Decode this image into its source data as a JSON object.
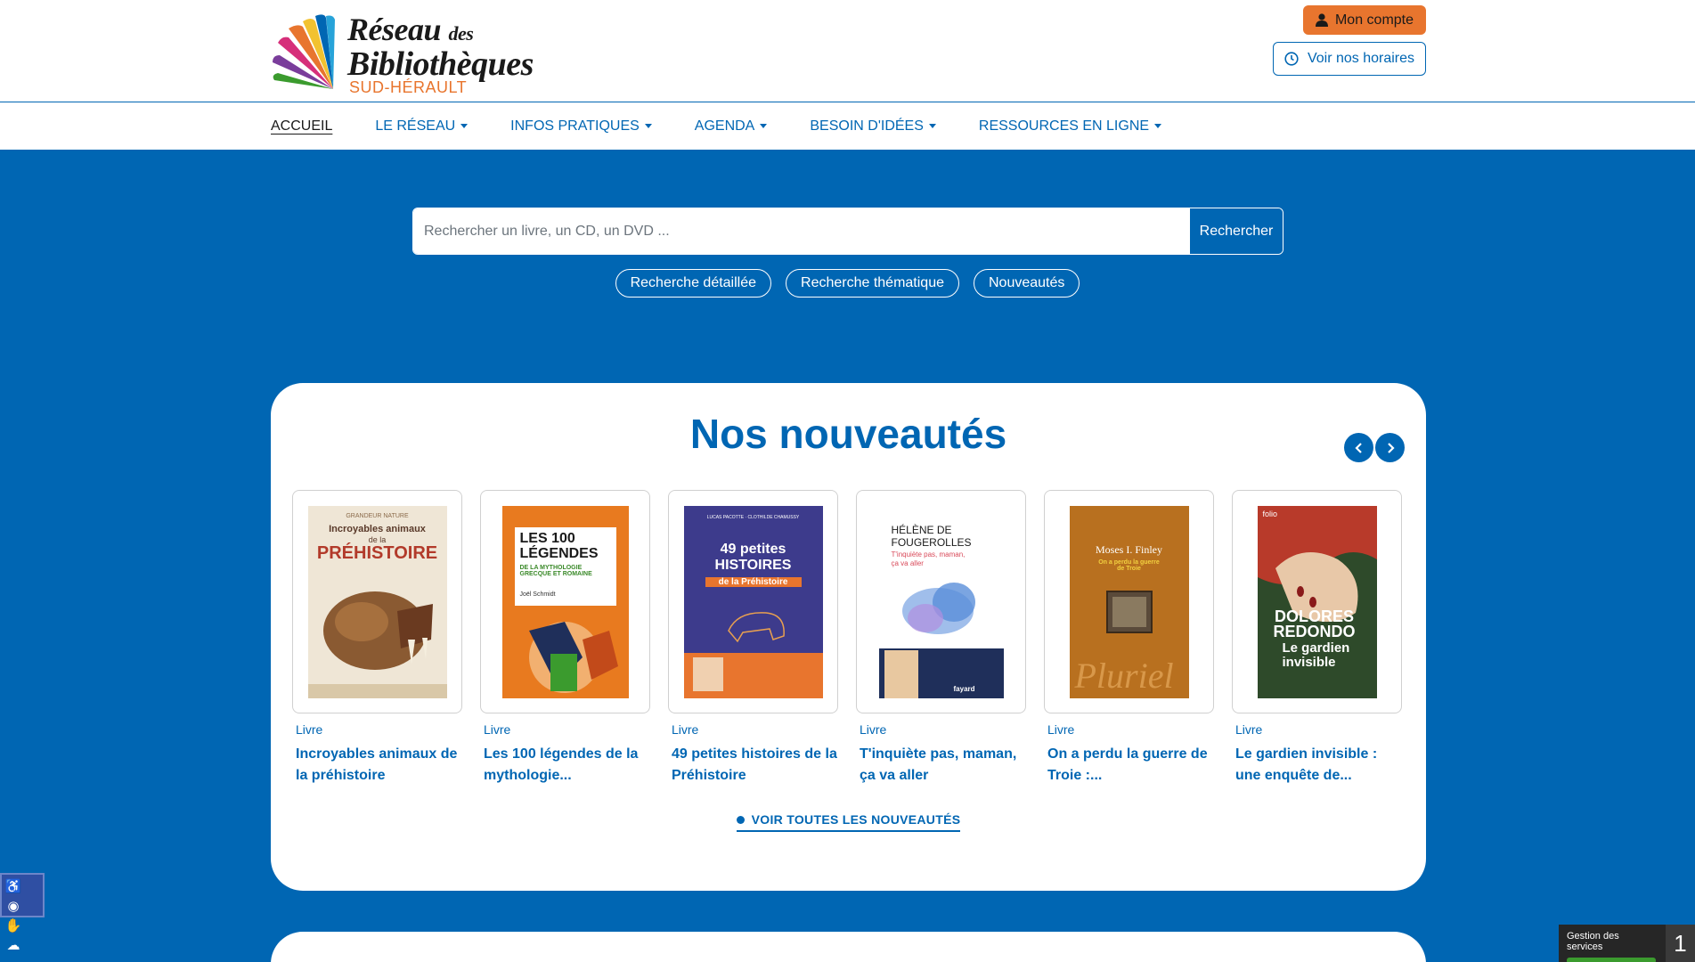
{
  "header": {
    "logo": {
      "line1": "Réseau",
      "line1_small": "des",
      "line2": "Bibliothèques",
      "line3": "SUD-HÉRAULT"
    },
    "account_label": "Mon compte",
    "hours_label": "Voir nos horaires"
  },
  "nav": {
    "items": [
      {
        "label": "ACCUEIL",
        "active": true
      },
      {
        "label": "LE RÉSEAU"
      },
      {
        "label": "INFOS PRATIQUES"
      },
      {
        "label": "AGENDA"
      },
      {
        "label": "BESOIN D'IDÉES"
      },
      {
        "label": "RESSOURCES EN LIGNE"
      }
    ]
  },
  "search": {
    "placeholder": "Rechercher un livre, un CD, un DVD ...",
    "button_label": "Rechercher",
    "pills": [
      "Recherche détaillée",
      "Recherche thématique",
      "Nouveautés"
    ]
  },
  "new_items": {
    "title": "Nos nouveautés",
    "see_all_label": "VOIR TOUTES LES NOUVEAUTÉS",
    "books": [
      {
        "type": "Livre",
        "title": "Incroyables animaux de la préhistoire",
        "cover_color": "#efe6d6"
      },
      {
        "type": "Livre",
        "title": "Les 100 légendes de la mythologie...",
        "cover_color": "#e87a1f"
      },
      {
        "type": "Livre",
        "title": "49 petites histoires de la Préhistoire",
        "cover_color": "#3d3b8c"
      },
      {
        "type": "Livre",
        "title": "T'inquiète pas, maman, ça va aller",
        "cover_color": "#ffffff"
      },
      {
        "type": "Livre",
        "title": "On a perdu la guerre de Troie :...",
        "cover_color": "#b8701f"
      },
      {
        "type": "Livre",
        "title": "Le gardien invisible : une enquête de...",
        "cover_color": "#2e5a2a"
      }
    ],
    "cover_texts": {
      "b1_top": "GRANDEUR NATURE",
      "b1_title": "Incroyables animaux",
      "b1_sub": "de la",
      "b1_main": "PRÉHISTOIRE",
      "b2_title": "LES 100 LÉGENDES",
      "b2_sub": "DE LA MYTHOLOGIE GRECQUE ET ROMAINE",
      "b2_author": "Joël Schmidt",
      "b3_author": "LUCAS PACOTTE · CLOTHILDE CHAMUSSY",
      "b3_title": "49 petites HISTOIRES",
      "b3_sub": "de la Préhistoire",
      "b4_author": "HÉLÈNE DE FOUGEROLLES",
      "b4_title": "T'inquiète pas, maman, ça va aller",
      "b4_pub": "fayard",
      "b5_author": "Moses I. Finley",
      "b5_title": "On a perdu la guerre de Troie",
      "b5_pub": "Pluriel",
      "b6_pub": "folio",
      "b6_author": "DOLORES REDONDO",
      "b6_title": "Le gardien invisible"
    }
  },
  "services": {
    "label": "Gestion des services",
    "count": "1"
  },
  "colors": {
    "primary": "#0066b3",
    "accent": "#e8752e"
  }
}
